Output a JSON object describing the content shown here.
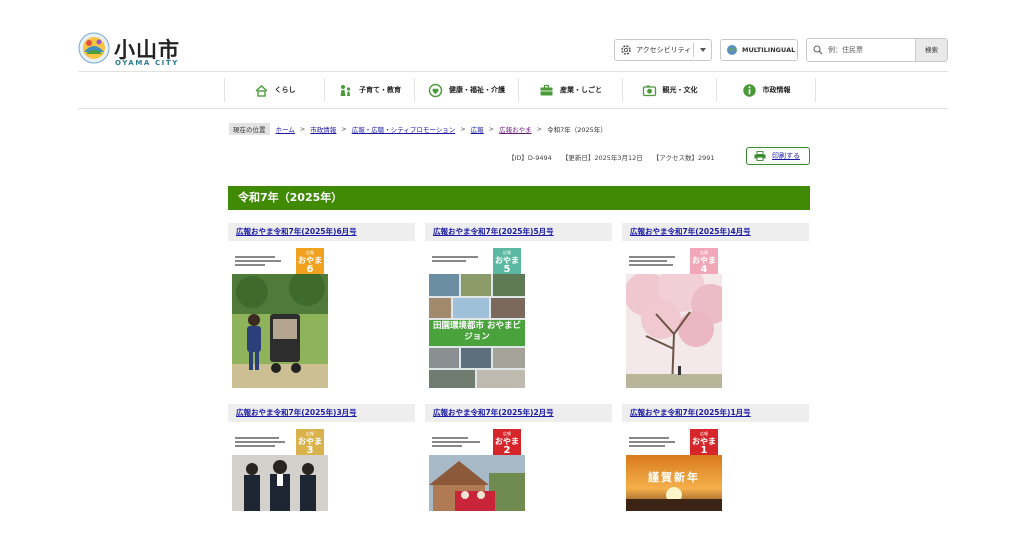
{
  "header": {
    "logo_ja": "小山市",
    "logo_en": "OYAMA CITY",
    "accessibility_label": "アクセシビリティ",
    "multilingual_label": "MULTILINGUAL",
    "search_placeholder": "例：住民票",
    "search_button": "検索"
  },
  "nav": {
    "items": [
      {
        "label": "くらし",
        "icon": "house-icon"
      },
      {
        "label": "子育て・教育",
        "icon": "family-icon"
      },
      {
        "label": "健康・福祉・介護",
        "icon": "health-icon"
      },
      {
        "label": "産業・しごと",
        "icon": "briefcase-icon"
      },
      {
        "label": "観光・文化",
        "icon": "camera-icon"
      },
      {
        "label": "市政情報",
        "icon": "info-icon"
      }
    ]
  },
  "breadcrumb": {
    "tag": "現在の位置",
    "links": [
      "ホーム",
      "市政情報",
      "広報・広聴・シティプロモーション",
      "広報",
      "広報おやま"
    ],
    "current": "令和7年（2025年）"
  },
  "meta": {
    "id": "【ID】D-9494",
    "updated": "【更新日】2025年3月12日",
    "access": "【アクセス数】2991",
    "print_label": "印刷する"
  },
  "page_title": "令和7年（2025年）",
  "issues": [
    {
      "title": "広報おやま令和7年(2025年)6月号",
      "issue_number": "6",
      "badge_name": "おやま",
      "badge_color": "#f0a21e"
    },
    {
      "title": "広報おやま令和7年(2025年)5月号",
      "issue_number": "5",
      "badge_name": "おやま",
      "badge_color": "#5bb8a2",
      "cover_banner": "田園環境都市 おやまビジョン"
    },
    {
      "title": "広報おやま令和7年(2025年)4月号",
      "issue_number": "4",
      "badge_name": "おやま",
      "badge_color": "#f2a7b8"
    },
    {
      "title": "広報おやま令和7年(2025年)3月号",
      "issue_number": "3",
      "badge_name": "おやま",
      "badge_color": "#d9b24c"
    },
    {
      "title": "広報おやま令和7年(2025年)2月号",
      "issue_number": "2",
      "badge_name": "おやま",
      "badge_color": "#d7262b"
    },
    {
      "title": "広報おやま令和7年(2025年)1月号",
      "issue_number": "1",
      "badge_name": "おやま",
      "badge_color": "#d7262b",
      "cover_banner": "謹賀新年"
    }
  ],
  "colors": {
    "accent_green": "#418a06",
    "link_blue": "#1a1aa6",
    "visited_purple": "#6b1f7a"
  }
}
